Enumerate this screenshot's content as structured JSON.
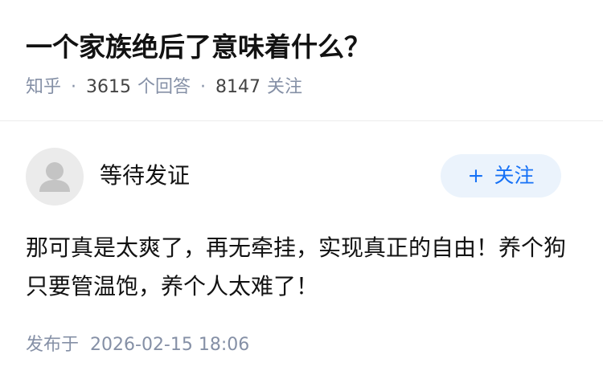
{
  "question": {
    "title": "一个家族绝后了意味着什么？",
    "source": "知乎",
    "separator": "·",
    "answer_count": "3615",
    "answer_label": "个回答",
    "follow_count": "8147",
    "follow_label": "关注"
  },
  "answer": {
    "author_name": "等待发证",
    "avatar_icon": "default-user-avatar-icon",
    "follow_button": {
      "icon": "+",
      "label": "关注"
    },
    "content": "那可真是太爽了，再无牵挂，实现真正的自由！养个狗只要管温饱，养个人太难了！",
    "publish_label": "发布于",
    "publish_time": "2026-02-15 18:06"
  },
  "colors": {
    "text_primary": "#121212",
    "text_secondary": "#8590a6",
    "accent": "#1772f6",
    "accent_bg": "#ebf3fc",
    "avatar_bg": "#ebebeb",
    "divider": "#ebebeb"
  }
}
